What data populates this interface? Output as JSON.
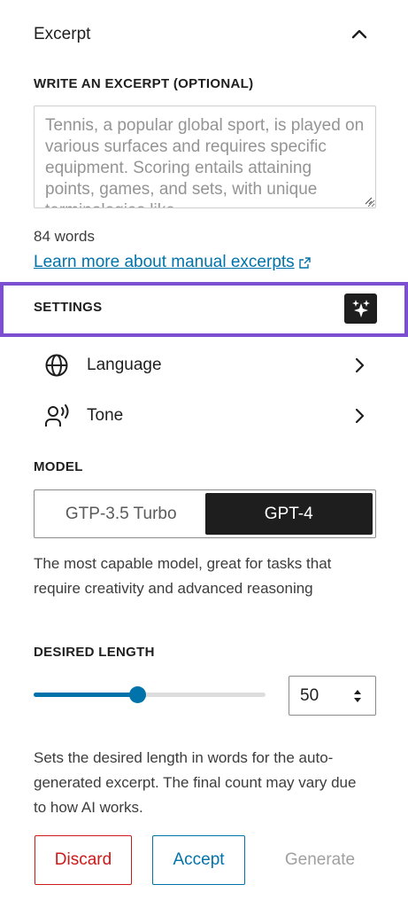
{
  "panel": {
    "title": "Excerpt",
    "collapse_icon": "chevron-up-icon"
  },
  "excerpt": {
    "label": "WRITE AN EXCERPT (OPTIONAL)",
    "placeholder": "Tennis, a popular global sport, is played on various surfaces and requires specific equipment. Scoring entails attaining points, games, and sets, with unique terminologies like",
    "word_count": "84 words",
    "learn_more": "Learn more about manual excerpts"
  },
  "settings": {
    "label": "SETTINGS",
    "sparkle_icon": "sparkles-icon",
    "highlight_color": "#7b4fd0",
    "items": [
      {
        "label": "Language",
        "icon": "globe-icon"
      },
      {
        "label": "Tone",
        "icon": "speaking-person-icon"
      }
    ]
  },
  "model": {
    "label": "MODEL",
    "options": [
      "GTP-3.5 Turbo",
      "GPT-4"
    ],
    "selected": "GPT-4",
    "description": "The most capable model, great for tasks that require creativity and advanced reasoning"
  },
  "length": {
    "label": "DESIRED LENGTH",
    "value": "50",
    "slider_fraction": 0.45,
    "description": "Sets the desired length in words for the auto-generated excerpt. The final count may vary due to how AI works."
  },
  "actions": {
    "discard": "Discard",
    "accept": "Accept",
    "generate": "Generate"
  },
  "colors": {
    "accent": "#0073aa",
    "danger": "#cc1818",
    "dark": "#1e1e1e"
  }
}
